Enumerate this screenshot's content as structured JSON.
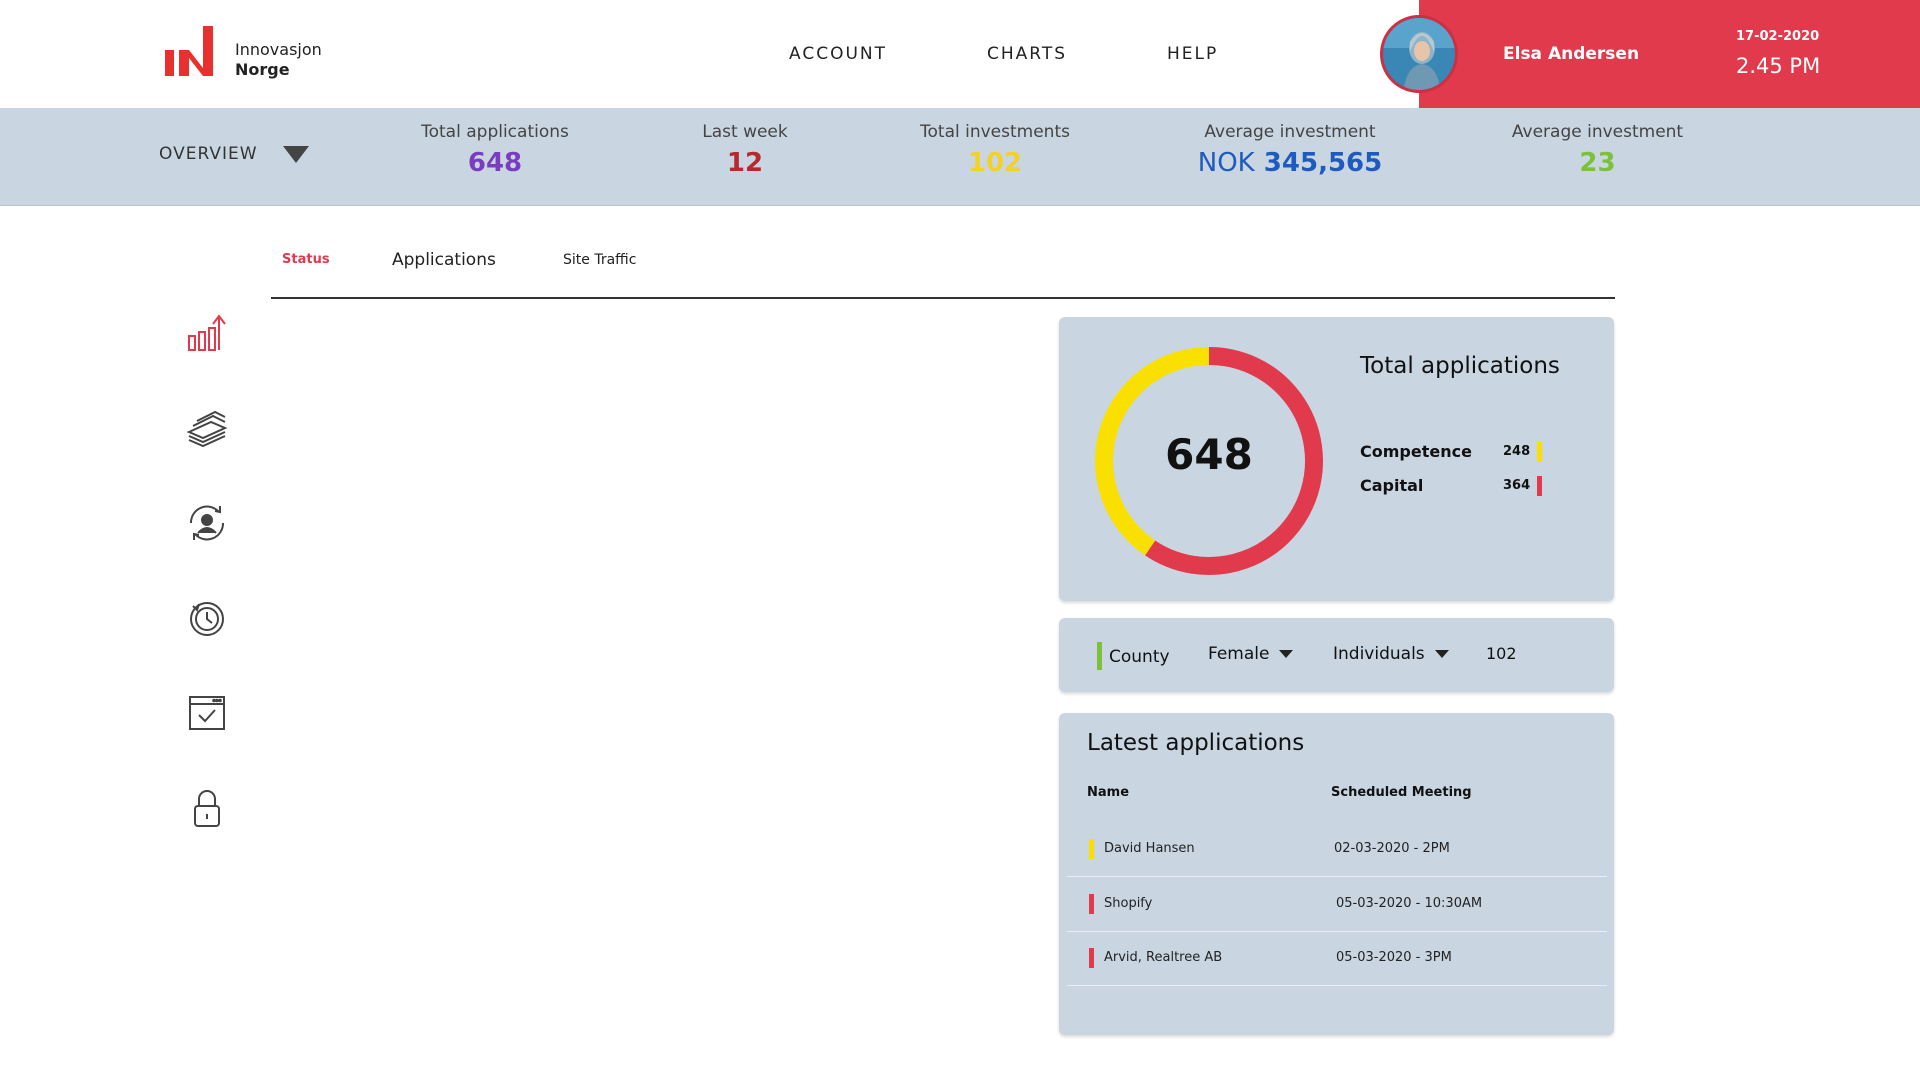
{
  "brand": {
    "line1": "Innovasjon",
    "line2": "Norge"
  },
  "nav": {
    "account": "ACCOUNT",
    "charts": "CHARTS",
    "help": "HELP"
  },
  "user": {
    "name": "Elsa Andersen",
    "date": "17-02-2020",
    "time": "2.45 PM"
  },
  "overview": {
    "label": "OVERVIEW",
    "stats": [
      {
        "label": "Total applications",
        "value": "648",
        "color": "#7b3dbf"
      },
      {
        "label": "Last week",
        "value": "12",
        "color": "#b52a2e"
      },
      {
        "label": "Total investments",
        "value": "102",
        "color": "#f2d12b"
      },
      {
        "label": "Average investment",
        "currency": "NOK",
        "value": "345,565",
        "color": "#1f5bbf"
      },
      {
        "label": "Average investment",
        "value": "23",
        "color": "#7cc13a"
      }
    ]
  },
  "tabs": {
    "status": "Status",
    "applications": "Applications",
    "site_traffic": "Site Traffic"
  },
  "sidebar_icons": [
    "bar-chart-growth-icon",
    "money-stack-icon",
    "user-sync-icon",
    "clock-history-icon",
    "calendar-check-icon",
    "lock-icon"
  ],
  "total_card": {
    "title": "Total applications",
    "total": "648",
    "items": [
      {
        "label": "Competence",
        "value": "248",
        "color": "#f9e000"
      },
      {
        "label": "Capital",
        "value": "364",
        "color": "#e03a4c"
      }
    ]
  },
  "chart_data": {
    "type": "pie",
    "title": "Total applications",
    "categories": [
      "Competence",
      "Capital"
    ],
    "values": [
      248,
      364
    ],
    "colors": [
      "#f9e000",
      "#e03a4c"
    ]
  },
  "filters": {
    "county": "County",
    "gender": "Female",
    "type": "Individuals",
    "count": "102"
  },
  "latest": {
    "title": "Latest applications",
    "columns": {
      "name": "Name",
      "meeting": "Scheduled Meeting"
    },
    "rows": [
      {
        "name": "David Hansen",
        "meeting": "02-03-2020 - 2PM",
        "color": "#f9e000"
      },
      {
        "name": "Shopify",
        "meeting": "05-03-2020 - 10:30AM",
        "color": "#e03a4c"
      },
      {
        "name": "Arvid, Realtree AB",
        "meeting": "05-03-2020 - 3PM",
        "color": "#e03a4c"
      }
    ]
  }
}
